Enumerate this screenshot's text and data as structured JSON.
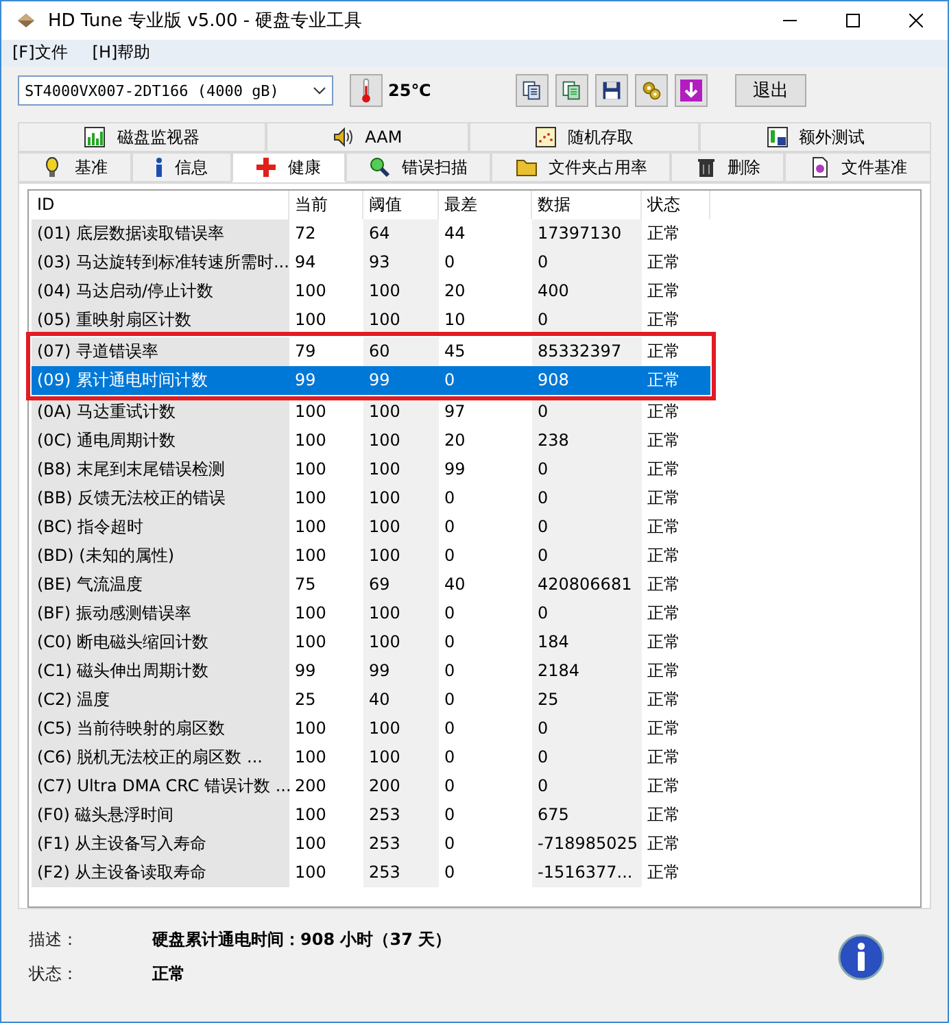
{
  "window": {
    "title": "HD Tune 专业版 v5.00 - 硬盘专业工具"
  },
  "menu": [
    "[F]文件",
    "[H]帮助"
  ],
  "toolbar": {
    "drive": "ST4000VX007-2DT166 (4000 gB)",
    "temperature": "25℃",
    "exit": "退出"
  },
  "tabs_top": [
    {
      "label": "磁盘监视器",
      "selected": false
    },
    {
      "label": "AAM",
      "selected": false
    },
    {
      "label": "随机存取",
      "selected": false
    },
    {
      "label": "额外测试",
      "selected": false
    }
  ],
  "tabs_bottom": [
    {
      "label": "基准",
      "selected": false
    },
    {
      "label": "信息",
      "selected": false
    },
    {
      "label": "健康",
      "selected": true
    },
    {
      "label": "错误扫描",
      "selected": false
    },
    {
      "label": "文件夹占用率",
      "selected": false
    },
    {
      "label": "删除",
      "selected": false
    },
    {
      "label": "文件基准",
      "selected": false
    }
  ],
  "table": {
    "columns": [
      "ID",
      "当前",
      "阈值",
      "最差",
      "数据",
      "状态"
    ],
    "rows": [
      {
        "cells": [
          "(01) 底层数据读取错误率",
          "72",
          "64",
          "44",
          "17397130",
          "正常"
        ],
        "selected": false,
        "marked": false
      },
      {
        "cells": [
          "(03) 马达旋转到标准转速所需时...",
          "94",
          "93",
          "0",
          "0",
          "正常"
        ],
        "selected": false,
        "marked": false
      },
      {
        "cells": [
          "(04) 马达启动/停止计数",
          "100",
          "100",
          "20",
          "400",
          "正常"
        ],
        "selected": false,
        "marked": false
      },
      {
        "cells": [
          "(05) 重映射扇区计数",
          "100",
          "100",
          "10",
          "0",
          "正常"
        ],
        "selected": false,
        "marked": false
      },
      {
        "cells": [
          "(07) 寻道错误率",
          "79",
          "60",
          "45",
          "85332397",
          "正常"
        ],
        "selected": false,
        "marked": true
      },
      {
        "cells": [
          "(09) 累计通电时间计数",
          "99",
          "99",
          "0",
          "908",
          "正常"
        ],
        "selected": true,
        "marked": true
      },
      {
        "cells": [
          "(0A) 马达重试计数",
          "100",
          "100",
          "97",
          "0",
          "正常"
        ],
        "selected": false,
        "marked": false
      },
      {
        "cells": [
          "(0C) 通电周期计数",
          "100",
          "100",
          "20",
          "238",
          "正常"
        ],
        "selected": false,
        "marked": false
      },
      {
        "cells": [
          "(B8) 末尾到末尾错误检测",
          "100",
          "100",
          "99",
          "0",
          "正常"
        ],
        "selected": false,
        "marked": false
      },
      {
        "cells": [
          "(BB) 反馈无法校正的错误",
          "100",
          "100",
          "0",
          "0",
          "正常"
        ],
        "selected": false,
        "marked": false
      },
      {
        "cells": [
          "(BC) 指令超时",
          "100",
          "100",
          "0",
          "0",
          "正常"
        ],
        "selected": false,
        "marked": false
      },
      {
        "cells": [
          "(BD) (未知的属性)",
          "100",
          "100",
          "0",
          "0",
          "正常"
        ],
        "selected": false,
        "marked": false
      },
      {
        "cells": [
          "(BE) 气流温度",
          "75",
          "69",
          "40",
          "420806681",
          "正常"
        ],
        "selected": false,
        "marked": false
      },
      {
        "cells": [
          "(BF) 振动感测错误率",
          "100",
          "100",
          "0",
          "0",
          "正常"
        ],
        "selected": false,
        "marked": false
      },
      {
        "cells": [
          "(C0) 断电磁头缩回计数",
          "100",
          "100",
          "0",
          "184",
          "正常"
        ],
        "selected": false,
        "marked": false
      },
      {
        "cells": [
          "(C1) 磁头伸出周期计数",
          "99",
          "99",
          "0",
          "2184",
          "正常"
        ],
        "selected": false,
        "marked": false
      },
      {
        "cells": [
          "(C2) 温度",
          "25",
          "40",
          "0",
          "25",
          "正常"
        ],
        "selected": false,
        "marked": false
      },
      {
        "cells": [
          "(C5) 当前待映射的扇区数",
          "100",
          "100",
          "0",
          "0",
          "正常"
        ],
        "selected": false,
        "marked": false
      },
      {
        "cells": [
          "(C6) 脱机无法校正的扇区数     ...",
          "100",
          "100",
          "0",
          "0",
          "正常"
        ],
        "selected": false,
        "marked": false
      },
      {
        "cells": [
          "(C7) Ultra DMA CRC 错误计数 ...",
          "200",
          "200",
          "0",
          "0",
          "正常"
        ],
        "selected": false,
        "marked": false
      },
      {
        "cells": [
          "(F0) 磁头悬浮时间",
          "100",
          "253",
          "0",
          "675",
          "正常"
        ],
        "selected": false,
        "marked": false
      },
      {
        "cells": [
          "(F1) 从主设备写入寿命",
          "100",
          "253",
          "0",
          "-718985025",
          "正常"
        ],
        "selected": false,
        "marked": false
      },
      {
        "cells": [
          "(F2) 从主设备读取寿命",
          "100",
          "253",
          "0",
          "-1516377...",
          "正常"
        ],
        "selected": false,
        "marked": false
      }
    ]
  },
  "details": [
    {
      "label": "描述：",
      "value": "硬盘累计通电时间：908 小时（37 天）"
    },
    {
      "label": "状态：",
      "value": "正常"
    }
  ]
}
